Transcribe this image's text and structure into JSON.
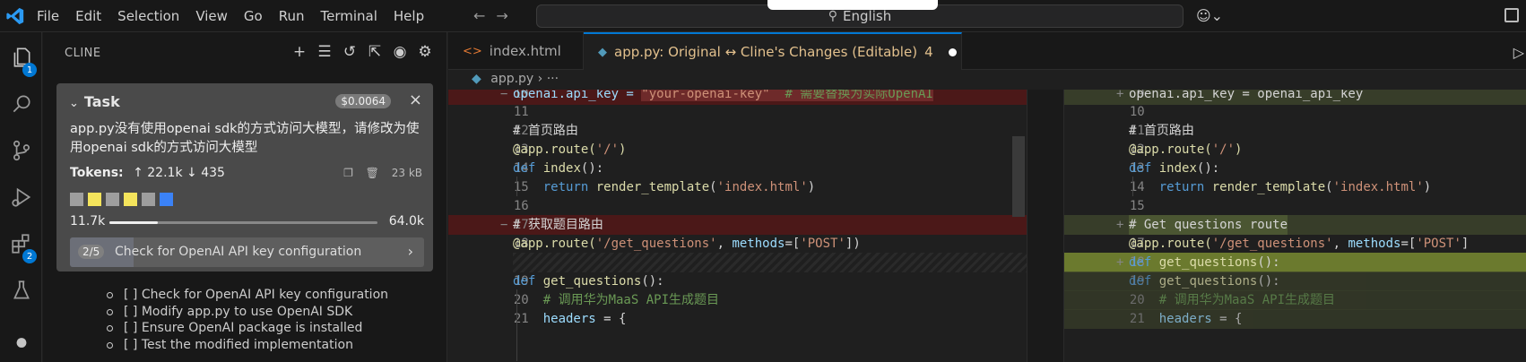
{
  "menu": [
    "File",
    "Edit",
    "Selection",
    "View",
    "Go",
    "Run",
    "Terminal",
    "Help"
  ],
  "search": {
    "text": "English"
  },
  "activity_badges": {
    "explorer": "1",
    "extensions": "2"
  },
  "sidebar": {
    "title": "CLINE",
    "task": {
      "heading": "Task",
      "cost": "$0.0064",
      "text": "app.py没有使用openai sdk的方式访问大模型，请修改为使用openai sdk的方式访问大模型",
      "tokens_label": "Tokens:",
      "tokens_in": "↑ 22.1k",
      "tokens_out": "↓ 435",
      "size": "23 kB",
      "context_used": "11.7k",
      "context_max": "64.0k",
      "context_fraction": 0.18,
      "swatch_colors": [
        "#9e9e9e",
        "#f4e45c",
        "#9e9e9e",
        "#f4e45c",
        "#9e9e9e",
        "#3b82f6"
      ],
      "step_badge": "2/5",
      "step_text": "Check for OpenAI API key configuration"
    },
    "checklist": [
      "[ ] Check for OpenAI API key configuration",
      "[ ] Modify app.py to use OpenAI SDK",
      "[ ] Ensure OpenAI package is installed",
      "[ ] Test the modified implementation"
    ]
  },
  "tabs": [
    {
      "label": "index.html"
    },
    {
      "label": "app.py: Original ↔ Cline's Changes (Editable)",
      "count": "4"
    }
  ],
  "breadcrumb": {
    "file": "app.py",
    "rest": "› ···"
  },
  "left_lines": [
    {
      "no": "10",
      "mark": "−"
    },
    {
      "no": "11"
    },
    {
      "no": "12"
    },
    {
      "no": "13"
    },
    {
      "no": "14"
    },
    {
      "no": "15"
    },
    {
      "no": "16"
    },
    {
      "no": "17",
      "mark": "−"
    },
    {
      "no": "18"
    },
    {
      "no": ""
    },
    {
      "no": "19"
    },
    {
      "no": "20"
    },
    {
      "no": "21"
    }
  ],
  "right_lines": [
    {
      "no": "9",
      "mark": "+"
    },
    {
      "no": "10"
    },
    {
      "no": "11"
    },
    {
      "no": "12"
    },
    {
      "no": "13"
    },
    {
      "no": "14"
    },
    {
      "no": "15"
    },
    {
      "no": "16",
      "mark": "+"
    },
    {
      "no": "17"
    },
    {
      "no": "18",
      "mark": "+"
    },
    {
      "no": "19"
    },
    {
      "no": "20"
    },
    {
      "no": "21"
    }
  ],
  "code": {
    "l10a": "openai.api_key = ",
    "l10b": "\"your-openai-key\"",
    "l10c": "  # 需要替换为实际OpenAI",
    "comment_home": "# 首页路由",
    "route_home_a": "@app.route(",
    "route_home_b": "'/'",
    "route_close": ")",
    "def_kw": "def",
    "index_fn": "index",
    "paren_colon": "():",
    "return_kw": "return",
    "render": "render_template",
    "index_html": "'index.html'",
    "comment_get_zh": "# 获取题目路由",
    "route_get_a": "@app.route(",
    "route_get_b": "'/get_questions'",
    "route_get_c": ", ",
    "methods": "methods",
    "route_get_d": "=[",
    "post": "'POST'",
    "route_get_e": "])",
    "get_fn": "get_questions",
    "comment_maas": "# 调用华为MaaS API生成题目",
    "headers": "headers",
    "headers_eq": " = {",
    "r9a": "openai.api_key = openai_api_key",
    "comment_get_en": "# Get questions route",
    "route_get_e_trunc": "]"
  }
}
